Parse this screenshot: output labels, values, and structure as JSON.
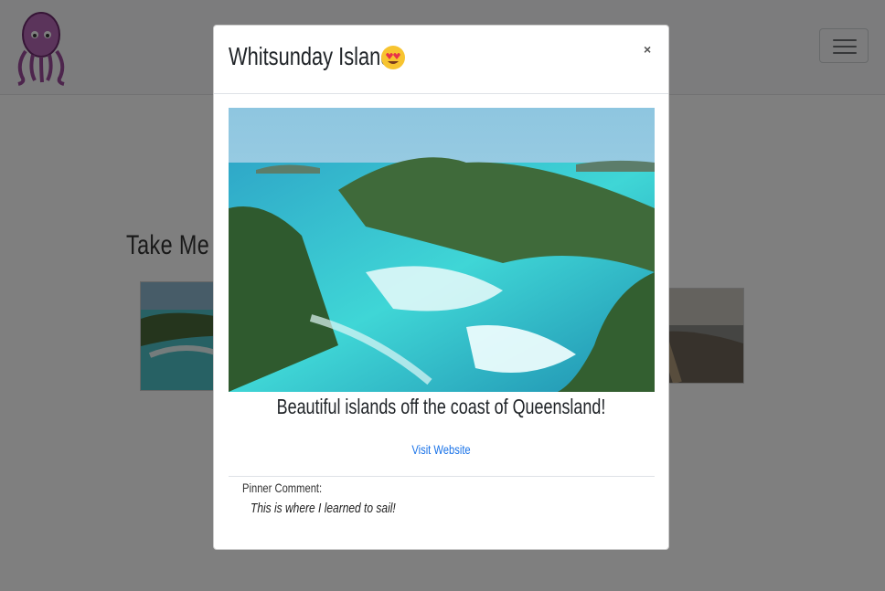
{
  "page": {
    "board_title": "Take Me Th"
  },
  "modal": {
    "title": "Whitsunday Islands",
    "title_emoji": "heart-eyes-emoji",
    "close_label": "×",
    "caption": "Beautiful islands off the coast of Queensland!",
    "visit_label": "Visit Website",
    "pinner_label": "Pinner Comment:",
    "pinner_comment": "This is where I learned to sail!"
  },
  "colors": {
    "logo_purple": "#b04ab0",
    "link_blue": "#1a73e8",
    "turquoise": "#3fd6d6",
    "backdrop": "#000000"
  }
}
